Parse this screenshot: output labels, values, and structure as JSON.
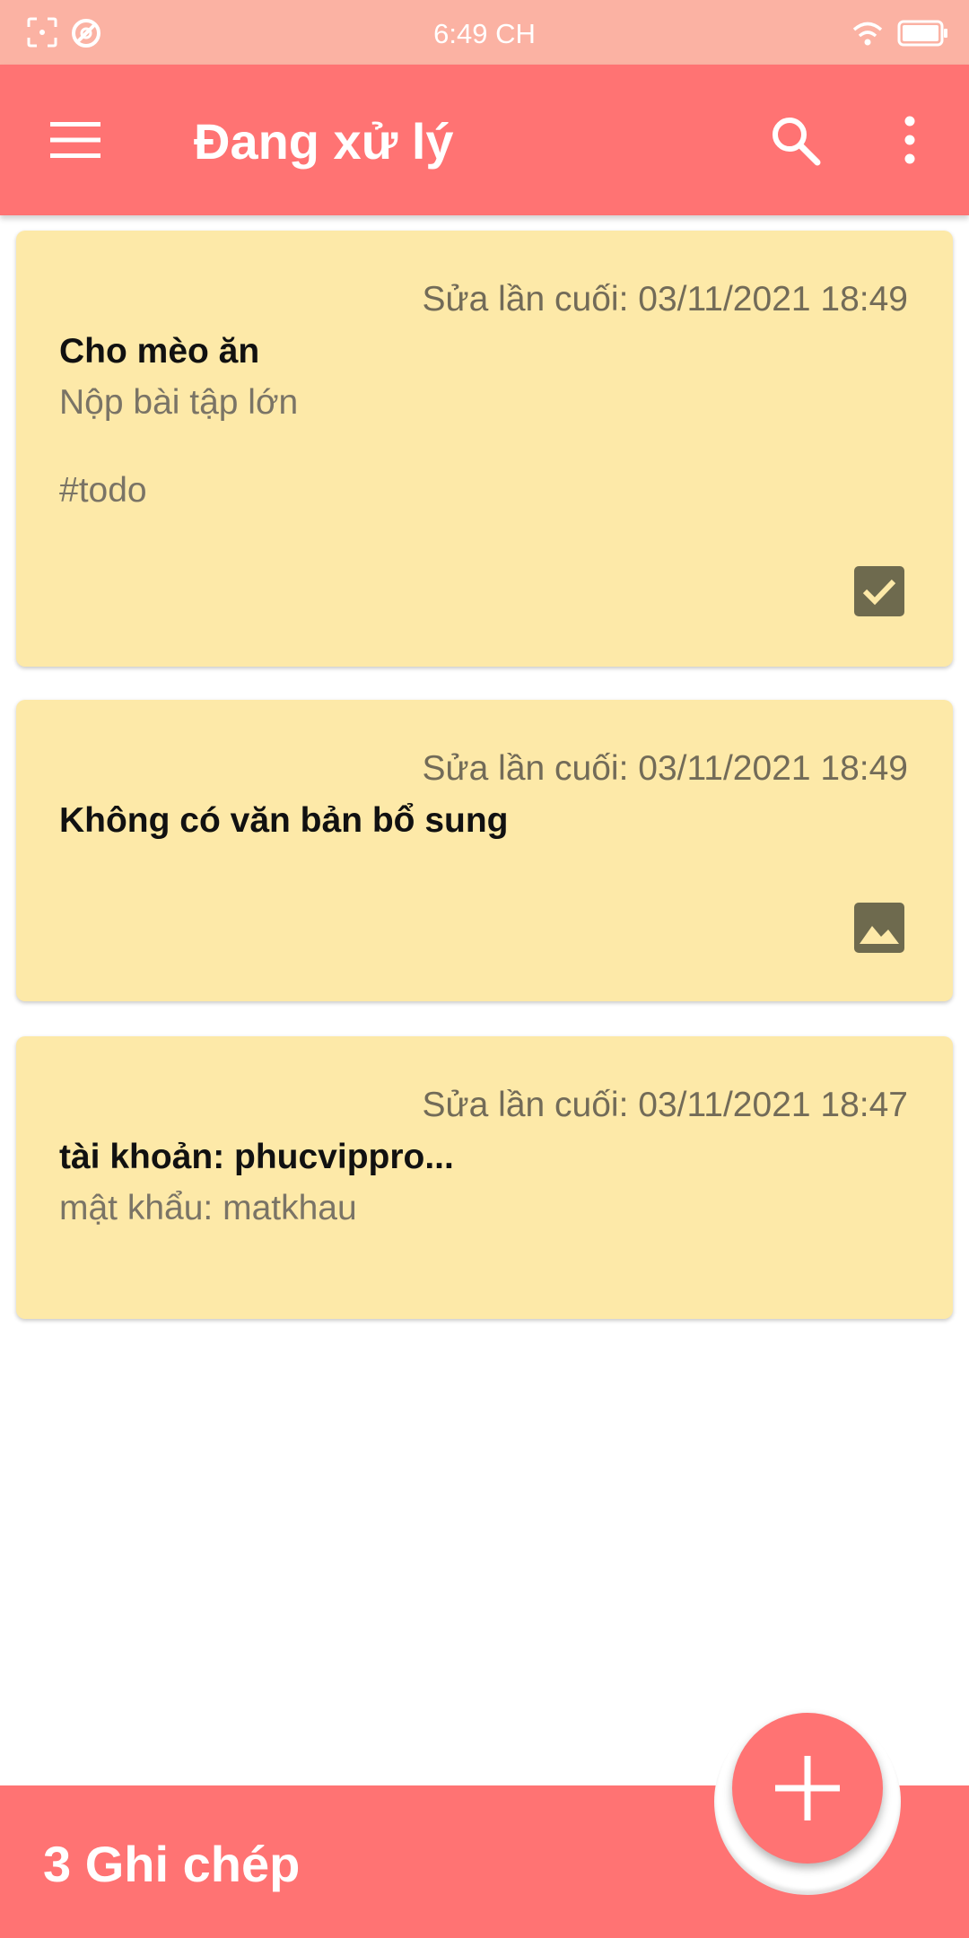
{
  "status_bar": {
    "time": "6:49 CH",
    "icons": [
      "screenshot-icon",
      "sync-icon",
      "wifi-icon",
      "battery-icon"
    ]
  },
  "app_bar": {
    "title": "Đang xử lý",
    "icons": [
      "menu-icon",
      "search-icon",
      "more-vert-icon"
    ]
  },
  "notes": [
    {
      "modified": "Sửa lần cuối: 03/11/2021 18:49",
      "title": "Cho mèo ăn",
      "body": "Nộp bài tập lớn",
      "tag": "#todo",
      "icon": "checkbox-icon"
    },
    {
      "modified": "Sửa lần cuối: 03/11/2021 18:49",
      "title": "Không có văn bản bổ sung",
      "icon": "image-icon"
    },
    {
      "modified": "Sửa lần cuối: 03/11/2021 18:47",
      "title": "tài khoản: phucvippro...",
      "body": "mật khẩu: matkhau"
    }
  ],
  "bottom_bar": {
    "count_label": "3 Ghi chép",
    "fab_icon": "add-icon"
  },
  "colors": {
    "primary": "#ff7373",
    "status_bar": "#fbb2a3",
    "note_background": "#fde9a8",
    "note_icon": "#6e6a4e"
  }
}
